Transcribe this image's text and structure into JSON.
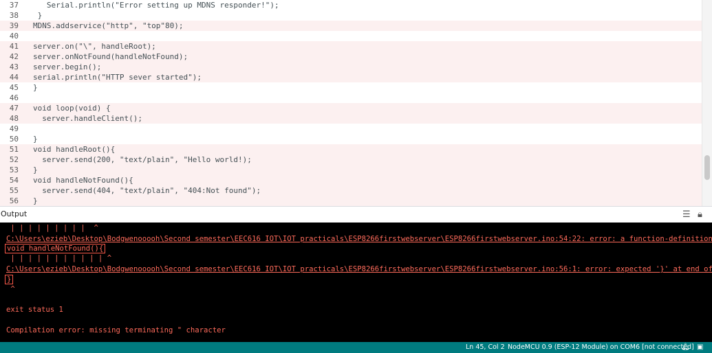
{
  "editor": {
    "lines": [
      {
        "n": "37",
        "code": "   Serial.println(\"Error setting up MDNS responder!\");"
      },
      {
        "n": "38",
        "code": " }"
      },
      {
        "n": "39",
        "code": "MDNS.addservice(\"http\", \"top\"80);"
      },
      {
        "n": "40",
        "code": ""
      },
      {
        "n": "41",
        "code": "server.on(\"\\\", handleRoot);"
      },
      {
        "n": "42",
        "code": "server.onNotFound(handleNotFound);"
      },
      {
        "n": "43",
        "code": "server.begin();"
      },
      {
        "n": "44",
        "code": "serial.println(\"HTTP sever started\");"
      },
      {
        "n": "45",
        "code": "}"
      },
      {
        "n": "46",
        "code": ""
      },
      {
        "n": "47",
        "code": "void loop(void) {"
      },
      {
        "n": "48",
        "code": "  server.handleClient();"
      },
      {
        "n": "49",
        "code": ""
      },
      {
        "n": "50",
        "code": "}"
      },
      {
        "n": "51",
        "code": "void handleRoot(){"
      },
      {
        "n": "52",
        "code": "  server.send(200, \"text/plain\", \"Hello world!);"
      },
      {
        "n": "53",
        "code": "}"
      },
      {
        "n": "54",
        "code": "void handleNotFound(){"
      },
      {
        "n": "55",
        "code": "  server.send(404, \"text/plain\", \"404:Not found\");"
      },
      {
        "n": "56",
        "code": "}"
      }
    ]
  },
  "output": {
    "title": "Output",
    "icons": [
      "clear-output-icon",
      "lock-scroll-icon"
    ],
    "lines": [
      {
        "text": " | | | | | | | | |  ^",
        "style": "plain"
      },
      {
        "text": "C:\\Users\\ezieb\\Desktop\\Bodgwenooooh\\Second semester\\EEC616 IOT\\IOT practicals\\ESP8266firstwebserver\\ESP8266firstwebserver.ino:54:22: error: a function-definition is not",
        "style": "err"
      },
      {
        "text": "void handleNotFound(){",
        "style": "boxed"
      },
      {
        "text": " | | | | | | | | | | | ^",
        "style": "plain"
      },
      {
        "text": "C:\\Users\\ezieb\\Desktop\\Bodgwenooooh\\Second semester\\EEC616 IOT\\IOT practicals\\ESP8266firstwebserver\\ESP8266firstwebserver.ino:56:1: error: expected '}' at end of input",
        "style": "err"
      },
      {
        "text": "}",
        "style": "boxed"
      },
      {
        "text": " ^",
        "style": "plain"
      },
      {
        "text": "",
        "style": "plain"
      },
      {
        "text": "exit status 1",
        "style": "plain"
      },
      {
        "text": "",
        "style": "plain"
      },
      {
        "text": "Compilation error: missing terminating \" character",
        "style": "plain"
      }
    ]
  },
  "status": {
    "position": "Ln 45, Col 2",
    "board": "NodeMCU 0.9 (ESP-12 Module) on COM6 [not connected]"
  },
  "colors": {
    "status_bar": "#007b7f",
    "error_text": "#ff6b5b",
    "console_bg": "#000000",
    "keyword": "#00979c",
    "function": "#d35400"
  }
}
